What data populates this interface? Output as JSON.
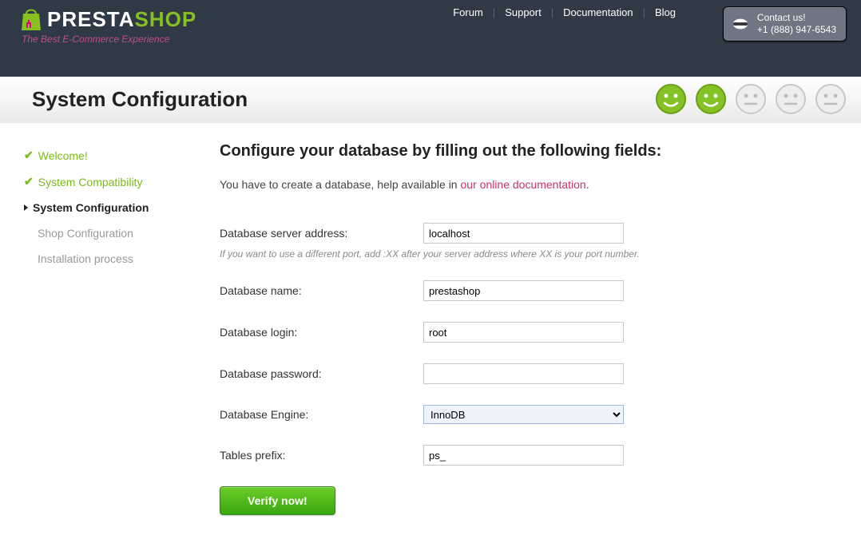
{
  "header": {
    "logo_presta": "PRESTA",
    "logo_shop": "SHOP",
    "tagline": "The Best E-Commerce Experience",
    "nav": {
      "forum": "Forum",
      "support": "Support",
      "documentation": "Documentation",
      "blog": "Blog"
    },
    "contact": {
      "label": "Contact us!",
      "phone": "+1 (888) 947-6543"
    }
  },
  "title": "System Configuration",
  "sidebar": {
    "welcome": "Welcome!",
    "compat": "System Compatibility",
    "sysconf": "System Configuration",
    "shopconf": "Shop Configuration",
    "install": "Installation process"
  },
  "main": {
    "heading": "Configure your database by filling out the following fields:",
    "intro_before": "You have to create a database, help available in ",
    "intro_link": "our online documentation",
    "intro_after": ".",
    "labels": {
      "server": "Database server address:",
      "server_hint": "If you want to use a different port, add :XX after your server address where XX is your port number.",
      "dbname": "Database name:",
      "login": "Database login:",
      "password": "Database password:",
      "engine": "Database Engine:",
      "prefix": "Tables prefix:"
    },
    "values": {
      "server": "localhost",
      "dbname": "prestashop",
      "login": "root",
      "password": "",
      "engine": "InnoDB",
      "prefix": "ps_"
    },
    "verify": "Verify now!"
  }
}
